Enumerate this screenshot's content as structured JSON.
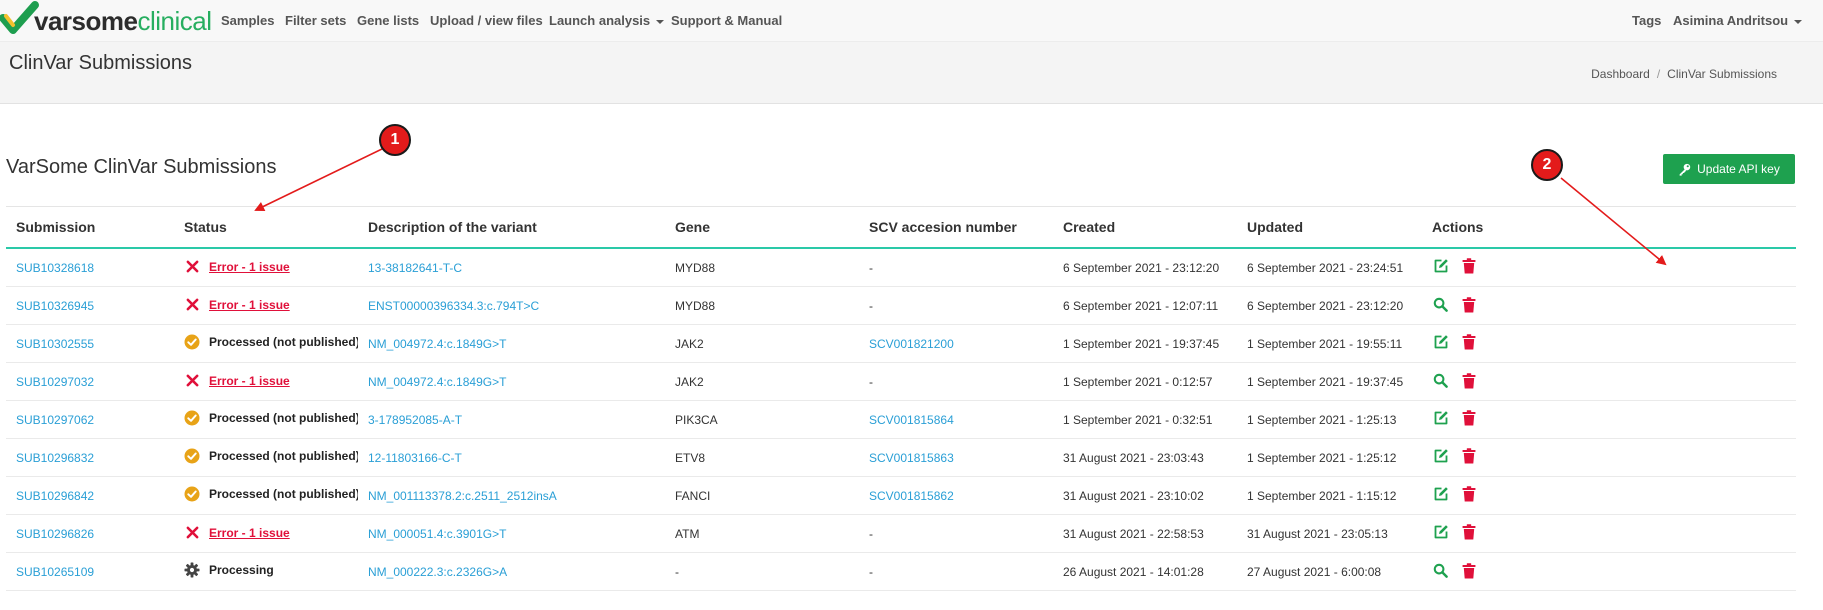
{
  "brand": {
    "part1": "varsome",
    "part2": "clinical",
    "accent": "#27ae60"
  },
  "nav": {
    "samples": "Samples",
    "filter_sets": "Filter sets",
    "gene_lists": "Gene lists",
    "upload": "Upload / view files",
    "launch": "Launch analysis",
    "support": "Support & Manual",
    "tags": "Tags",
    "user": "Asimina Andritsou"
  },
  "header": {
    "title": "ClinVar Submissions",
    "breadcrumb": [
      "Dashboard",
      "ClinVar Submissions"
    ]
  },
  "section": {
    "title": "VarSome ClinVar Submissions",
    "api_button": "Update API key",
    "api_button_color": "#1ea14f"
  },
  "table": {
    "columns": [
      "Submission",
      "Status",
      "Description of the variant",
      "Gene",
      "SCV accesion number",
      "Created",
      "Updated",
      "Actions"
    ],
    "rows": [
      {
        "submission": "SUB10328618",
        "status": "Error - 1 issue",
        "status_type": "error",
        "description": "13-38182641-T-C",
        "gene": "MYD88",
        "scv": "-",
        "created": "6 September 2021 - 23:12:20",
        "updated": "6 September 2021 - 23:24:51",
        "primary_action": "edit-icon"
      },
      {
        "submission": "SUB10326945",
        "status": "Error - 1 issue",
        "status_type": "error",
        "description": "ENST00000396334.3:c.794T>C",
        "gene": "MYD88",
        "scv": "-",
        "created": "6 September 2021 - 12:07:11",
        "updated": "6 September 2021 - 23:12:20",
        "primary_action": "search-icon"
      },
      {
        "submission": "SUB10302555",
        "status": "Processed (not published)",
        "status_type": "processed",
        "description": "NM_004972.4:c.1849G>T",
        "gene": "JAK2",
        "scv": "SCV001821200",
        "created": "1 September 2021 - 19:37:45",
        "updated": "1 September 2021 - 19:55:11",
        "primary_action": "edit-icon"
      },
      {
        "submission": "SUB10297032",
        "status": "Error - 1 issue",
        "status_type": "error",
        "description": "NM_004972.4:c.1849G>T",
        "gene": "JAK2",
        "scv": "-",
        "created": "1 September 2021 - 0:12:57",
        "updated": "1 September 2021 - 19:37:45",
        "primary_action": "search-icon"
      },
      {
        "submission": "SUB10297062",
        "status": "Processed (not published)",
        "status_type": "processed",
        "description": "3-178952085-A-T",
        "gene": "PIK3CA",
        "scv": "SCV001815864",
        "created": "1 September 2021 - 0:32:51",
        "updated": "1 September 2021 - 1:25:13",
        "primary_action": "edit-icon"
      },
      {
        "submission": "SUB10296832",
        "status": "Processed (not published)",
        "status_type": "processed",
        "description": "12-11803166-C-T",
        "gene": "ETV8",
        "scv": "SCV001815863",
        "created": "31 August 2021 - 23:03:43",
        "updated": "1 September 2021 - 1:25:12",
        "primary_action": "edit-icon"
      },
      {
        "submission": "SUB10296842",
        "status": "Processed (not published)",
        "status_type": "processed",
        "description": "NM_001113378.2:c.2511_2512insA",
        "gene": "FANCI",
        "scv": "SCV001815862",
        "created": "31 August 2021 - 23:10:02",
        "updated": "1 September 2021 - 1:15:12",
        "primary_action": "edit-icon"
      },
      {
        "submission": "SUB10296826",
        "status": "Error - 1 issue",
        "status_type": "error",
        "description": "NM_000051.4:c.3901G>T",
        "gene": "ATM",
        "scv": "-",
        "created": "31 August 2021 - 22:58:53",
        "updated": "31 August 2021 - 23:05:13",
        "primary_action": "edit-icon"
      },
      {
        "submission": "SUB10265109",
        "status": "Processing",
        "status_type": "processing",
        "description": "NM_000222.3:c.2326G>A",
        "gene": "-",
        "scv": "-",
        "created": "26 August 2021 - 14:01:28",
        "updated": "27 August 2021 - 6:00:08",
        "primary_action": "search-icon"
      }
    ]
  },
  "annotations": [
    "1",
    "2"
  ],
  "colors": {
    "link": "#2a9fd6",
    "error": "#e0103a",
    "processed": "#e8a317",
    "processing": "#444444",
    "edit": "#1ea14f",
    "delete": "#e0103a",
    "header_rule": "#2ac9a8",
    "annotation": "#e31b1b"
  }
}
